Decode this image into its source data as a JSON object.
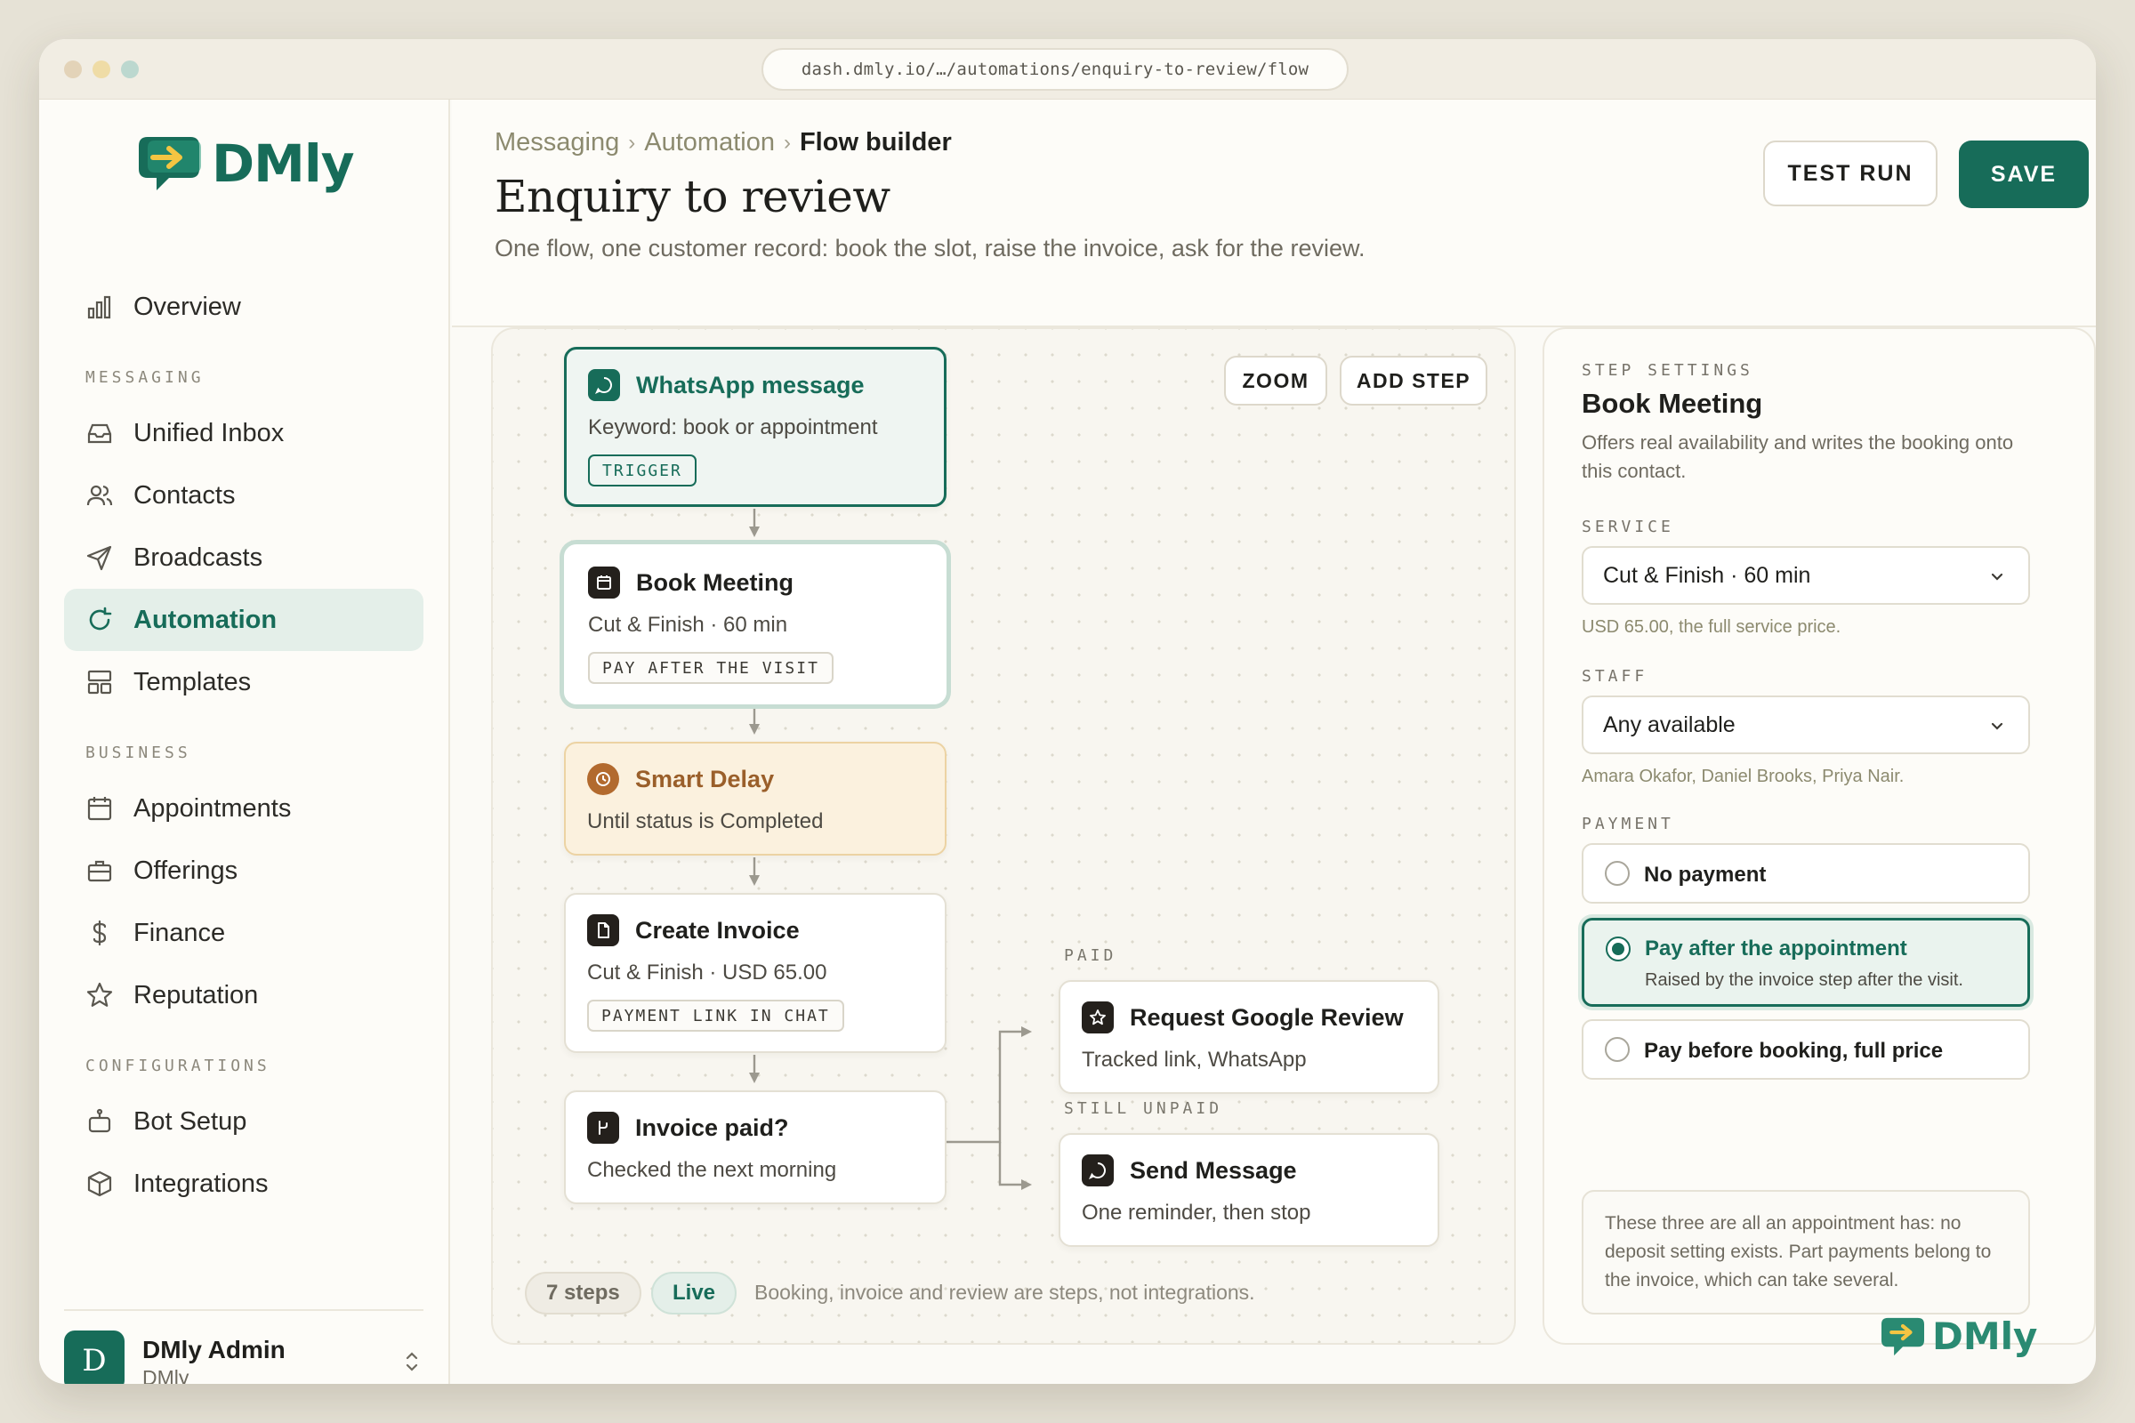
{
  "browser": {
    "url": "dash.dmly.io/…/automations/enquiry-to-review/flow"
  },
  "brand": {
    "name": "DMly",
    "color": "#176c59"
  },
  "sidebar": {
    "overview": "Overview",
    "sections": [
      {
        "label": "MESSAGING",
        "items": [
          {
            "label": "Unified Inbox",
            "icon": "inbox-icon"
          },
          {
            "label": "Contacts",
            "icon": "users-icon"
          },
          {
            "label": "Broadcasts",
            "icon": "send-icon"
          },
          {
            "label": "Automation",
            "icon": "refresh-icon",
            "active": true
          },
          {
            "label": "Templates",
            "icon": "layout-icon"
          }
        ]
      },
      {
        "label": "BUSINESS",
        "items": [
          {
            "label": "Appointments",
            "icon": "calendar-icon"
          },
          {
            "label": "Offerings",
            "icon": "briefcase-icon"
          },
          {
            "label": "Finance",
            "icon": "dollar-icon"
          },
          {
            "label": "Reputation",
            "icon": "star-icon"
          }
        ]
      },
      {
        "label": "CONFIGURATIONS",
        "items": [
          {
            "label": "Bot Setup",
            "icon": "bot-icon"
          },
          {
            "label": "Integrations",
            "icon": "cube-icon"
          }
        ]
      }
    ],
    "user": {
      "initial": "D",
      "name": "DMly Admin",
      "org": "DMly"
    }
  },
  "header": {
    "breadcrumb": [
      "Messaging",
      "Automation",
      "Flow builder"
    ],
    "title": "Enquiry to review",
    "subtitle": "One flow, one customer record: book the slot, raise the invoice, ask for the review.",
    "test_run": "TEST RUN",
    "save": "SAVE"
  },
  "canvas": {
    "zoom": "ZOOM",
    "add_step": "ADD STEP",
    "nodes": {
      "trigger": {
        "title": "WhatsApp message",
        "desc": "Keyword: book or appointment",
        "tag": "TRIGGER"
      },
      "book": {
        "title": "Book Meeting",
        "desc": "Cut & Finish · 60 min",
        "tag": "PAY AFTER THE VISIT"
      },
      "delay": {
        "title": "Smart Delay",
        "desc": "Until status is Completed"
      },
      "invoice": {
        "title": "Create Invoice",
        "desc": "Cut & Finish · USD 65.00",
        "tag": "PAYMENT LINK IN CHAT"
      },
      "check": {
        "title": "Invoice paid?",
        "desc": "Checked the next morning"
      },
      "review": {
        "title": "Request Google Review",
        "desc": "Tracked link, WhatsApp"
      },
      "message": {
        "title": "Send Message",
        "desc": "One reminder, then stop"
      }
    },
    "branch_paid": "PAID",
    "branch_unpaid": "STILL UNPAID",
    "footer": {
      "steps": "7 steps",
      "status": "Live",
      "note": "Booking, invoice and review are steps, not integrations."
    }
  },
  "settings": {
    "section": "STEP SETTINGS",
    "title": "Book Meeting",
    "desc": "Offers real availability and writes the booking onto this contact.",
    "service_label": "SERVICE",
    "service_value": "Cut & Finish · 60 min",
    "service_hint": "USD 65.00, the full service price.",
    "staff_label": "STAFF",
    "staff_value": "Any available",
    "staff_hint": "Amara Okafor, Daniel Brooks, Priya Nair.",
    "payment_label": "PAYMENT",
    "payment_options": [
      {
        "label": "No payment",
        "sub": ""
      },
      {
        "label": "Pay after the appointment",
        "sub": "Raised by the invoice step after the visit."
      },
      {
        "label": "Pay before booking, full price",
        "sub": ""
      }
    ],
    "payment_selected": 1,
    "note": "These three are all an appointment has: no deposit setting exists. Part payments belong to the invoice, which can take several."
  }
}
